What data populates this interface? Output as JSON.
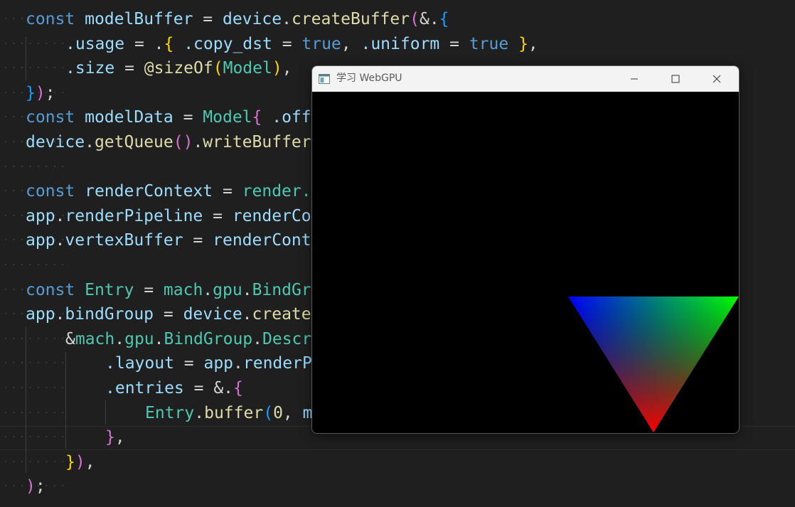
{
  "editor": {
    "lines": [
      {
        "tokens": [
          {
            "t": "const",
            "c": "kw"
          },
          {
            "t": " ",
            "c": "op"
          },
          {
            "t": "modelBuffer",
            "c": "va"
          },
          {
            "t": " = ",
            "c": "op"
          },
          {
            "t": "device",
            "c": "va"
          },
          {
            "t": ".",
            "c": "op"
          },
          {
            "t": "createBuffer",
            "c": "fn"
          },
          {
            "t": "(",
            "c": "b2"
          },
          {
            "t": "&.",
            "c": "op"
          },
          {
            "t": "{",
            "c": "b3"
          }
        ]
      },
      {
        "tokens": [
          {
            "t": ".usage",
            "c": "va"
          },
          {
            "t": " = ",
            "c": "op"
          },
          {
            "t": ".",
            "c": "op"
          },
          {
            "t": "{",
            "c": "b1"
          },
          {
            "t": " .copy_dst",
            "c": "va"
          },
          {
            "t": " = ",
            "c": "op"
          },
          {
            "t": "true",
            "c": "kw"
          },
          {
            "t": ", ",
            "c": "op"
          },
          {
            "t": ".uniform",
            "c": "va"
          },
          {
            "t": " = ",
            "c": "op"
          },
          {
            "t": "true",
            "c": "kw"
          },
          {
            "t": " ",
            "c": "op"
          },
          {
            "t": "}",
            "c": "b1"
          },
          {
            "t": ",",
            "c": "op"
          }
        ]
      },
      {
        "tokens": [
          {
            "t": ".size",
            "c": "va"
          },
          {
            "t": " = ",
            "c": "op"
          },
          {
            "t": "@sizeOf",
            "c": "fn"
          },
          {
            "t": "(",
            "c": "b1"
          },
          {
            "t": "Model",
            "c": "ty"
          },
          {
            "t": ")",
            "c": "b1"
          },
          {
            "t": ",",
            "c": "op"
          }
        ]
      },
      {
        "tokens": [
          {
            "t": "}",
            "c": "b3"
          },
          {
            "t": ")",
            "c": "b2"
          },
          {
            "t": ";",
            "c": "op"
          }
        ]
      },
      {
        "tokens": [
          {
            "t": "const",
            "c": "kw"
          },
          {
            "t": " ",
            "c": "op"
          },
          {
            "t": "modelData",
            "c": "va"
          },
          {
            "t": " = ",
            "c": "op"
          },
          {
            "t": "Model",
            "c": "ty"
          },
          {
            "t": "{",
            "c": "b2"
          },
          {
            "t": " .off",
            "c": "va"
          }
        ]
      },
      {
        "tokens": [
          {
            "t": "device",
            "c": "va"
          },
          {
            "t": ".",
            "c": "op"
          },
          {
            "t": "getQueue",
            "c": "fn"
          },
          {
            "t": "()",
            "c": "b2"
          },
          {
            "t": ".",
            "c": "op"
          },
          {
            "t": "writeBuffer",
            "c": "fn"
          }
        ]
      },
      {
        "tokens": []
      },
      {
        "tokens": [
          {
            "t": "const",
            "c": "kw"
          },
          {
            "t": " ",
            "c": "op"
          },
          {
            "t": "renderContext",
            "c": "va"
          },
          {
            "t": " = ",
            "c": "op"
          },
          {
            "t": "render.",
            "c": "ty"
          }
        ]
      },
      {
        "tokens": [
          {
            "t": "app",
            "c": "va"
          },
          {
            "t": ".",
            "c": "op"
          },
          {
            "t": "renderPipeline",
            "c": "va"
          },
          {
            "t": " = ",
            "c": "op"
          },
          {
            "t": "renderCo",
            "c": "va"
          }
        ]
      },
      {
        "tokens": [
          {
            "t": "app",
            "c": "va"
          },
          {
            "t": ".",
            "c": "op"
          },
          {
            "t": "vertexBuffer",
            "c": "va"
          },
          {
            "t": " = ",
            "c": "op"
          },
          {
            "t": "renderCont",
            "c": "va"
          }
        ]
      },
      {
        "tokens": []
      },
      {
        "tokens": [
          {
            "t": "const",
            "c": "kw"
          },
          {
            "t": " ",
            "c": "op"
          },
          {
            "t": "Entry",
            "c": "ty"
          },
          {
            "t": " = ",
            "c": "op"
          },
          {
            "t": "mach",
            "c": "ty"
          },
          {
            "t": ".",
            "c": "op"
          },
          {
            "t": "gpu",
            "c": "ty"
          },
          {
            "t": ".",
            "c": "op"
          },
          {
            "t": "BindGr",
            "c": "ty"
          }
        ]
      },
      {
        "tokens": [
          {
            "t": "app",
            "c": "va"
          },
          {
            "t": ".",
            "c": "op"
          },
          {
            "t": "bindGroup",
            "c": "va"
          },
          {
            "t": " = ",
            "c": "op"
          },
          {
            "t": "device",
            "c": "va"
          },
          {
            "t": ".",
            "c": "op"
          },
          {
            "t": "create",
            "c": "fn"
          }
        ]
      },
      {
        "tokens": [
          {
            "t": "&",
            "c": "op"
          },
          {
            "t": "mach",
            "c": "ty"
          },
          {
            "t": ".",
            "c": "op"
          },
          {
            "t": "gpu",
            "c": "ty"
          },
          {
            "t": ".",
            "c": "op"
          },
          {
            "t": "BindGroup",
            "c": "ty"
          },
          {
            "t": ".",
            "c": "op"
          },
          {
            "t": "Descr",
            "c": "ty"
          }
        ]
      },
      {
        "tokens": [
          {
            "t": ".layout",
            "c": "va"
          },
          {
            "t": " = ",
            "c": "op"
          },
          {
            "t": "app",
            "c": "va"
          },
          {
            "t": ".",
            "c": "op"
          },
          {
            "t": "renderP",
            "c": "va"
          }
        ]
      },
      {
        "tokens": [
          {
            "t": ".entries",
            "c": "va"
          },
          {
            "t": " = ",
            "c": "op"
          },
          {
            "t": "&.",
            "c": "op"
          },
          {
            "t": "{",
            "c": "b2"
          }
        ]
      },
      {
        "tokens": [
          {
            "t": "Entry",
            "c": "ty"
          },
          {
            "t": ".",
            "c": "op"
          },
          {
            "t": "buffer",
            "c": "fn"
          },
          {
            "t": "(",
            "c": "b3"
          },
          {
            "t": "0",
            "c": "bi"
          },
          {
            "t": ", ",
            "c": "op"
          },
          {
            "t": "m",
            "c": "va"
          }
        ]
      },
      {
        "tokens": [
          {
            "t": "}",
            "c": "b2"
          },
          {
            "t": ",",
            "c": "op"
          }
        ]
      },
      {
        "tokens": [
          {
            "t": "}",
            "c": "b1"
          },
          {
            "t": ")",
            "c": "b2"
          },
          {
            "t": ",",
            "c": "op"
          }
        ]
      },
      {
        "tokens": [
          {
            "t": ")",
            "c": "b2"
          },
          {
            "t": ";",
            "c": "op"
          }
        ]
      }
    ]
  },
  "window": {
    "title": "学习 WebGPU",
    "icon": "app-window-icon",
    "controls": {
      "minimize": "minimize-icon",
      "maximize": "maximize-icon",
      "close": "close-icon"
    },
    "triangle_colors": {
      "top_left": "#0000ff",
      "top_right": "#00ff00",
      "bottom": "#ff0000"
    }
  }
}
